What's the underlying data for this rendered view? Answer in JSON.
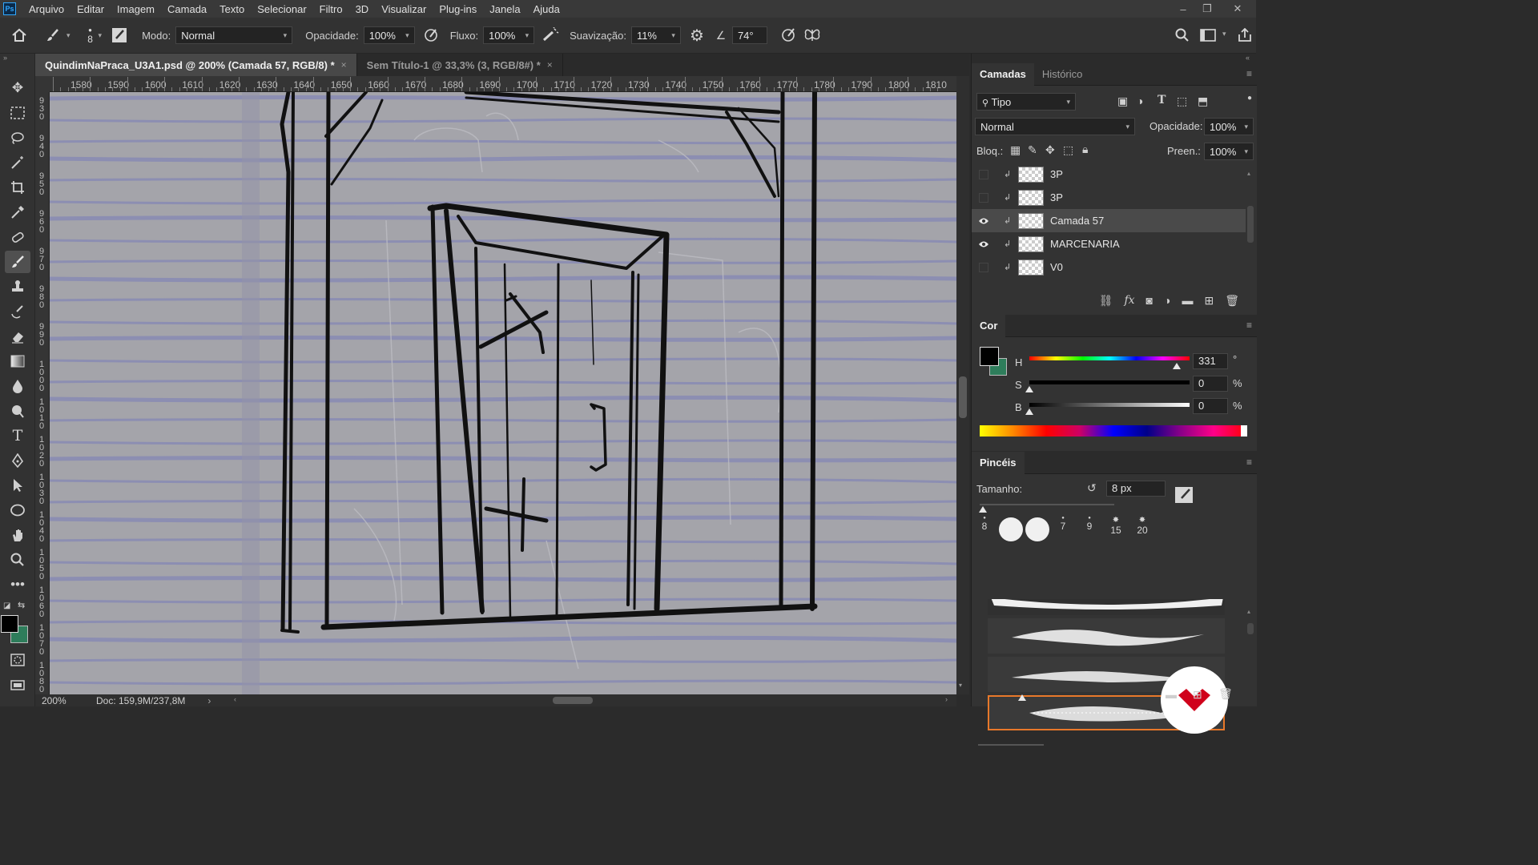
{
  "app": {
    "logo_text": "Ps",
    "menu": [
      "Arquivo",
      "Editar",
      "Imagem",
      "Camada",
      "Texto",
      "Selecionar",
      "Filtro",
      "3D",
      "Visualizar",
      "Plug-ins",
      "Janela",
      "Ajuda"
    ],
    "window_controls": {
      "minimize": "–",
      "restore": "❐",
      "close": "✕"
    }
  },
  "options": {
    "brush_size": "8",
    "mode_label": "Modo:",
    "mode_value": "Normal",
    "opacity_label": "Opacidade:",
    "opacity_value": "100%",
    "flow_label": "Fluxo:",
    "flow_value": "100%",
    "smoothing_label": "Suavização:",
    "smoothing_value": "11%",
    "angle_value": "74°"
  },
  "tabs": [
    {
      "label": "QuindimNaPraca_U3A1.psd @ 200% (Camada 57, RGB/8) *",
      "close": "×"
    },
    {
      "label": "Sem Título-1 @ 33,3% (3, RGB/8#) *",
      "close": "×"
    }
  ],
  "ruler": {
    "h_labels": [
      "1580",
      "1590",
      "1600",
      "1610",
      "1620",
      "1630",
      "1640",
      "1650",
      "1660",
      "1670",
      "1680",
      "1690",
      "1700",
      "1710",
      "1720",
      "1730",
      "1740",
      "1750",
      "1760",
      "1770",
      "1780",
      "1790",
      "1800",
      "1810"
    ],
    "v_labels": [
      "930",
      "940",
      "950",
      "960",
      "970",
      "980",
      "990",
      "1000",
      "1010",
      "1020",
      "1030",
      "1040",
      "1050",
      "1060",
      "1070",
      "1080"
    ]
  },
  "status": {
    "zoom": "200%",
    "doc": "Doc: 159,9M/237,8M",
    "arrow": "›"
  },
  "layers_panel": {
    "tabs": [
      "Camadas",
      "Histórico"
    ],
    "filter_label": "Tipo",
    "blend_mode": "Normal",
    "opacity_label": "Opacidade:",
    "opacity_value": "100%",
    "lock_label": "Bloq.:",
    "fill_label": "Preen.:",
    "fill_value": "100%",
    "layers": [
      {
        "name": "3P",
        "visible": false,
        "selected": false
      },
      {
        "name": "3P",
        "visible": false,
        "selected": false
      },
      {
        "name": "Camada 57",
        "visible": true,
        "selected": true
      },
      {
        "name": "MARCENARIA",
        "visible": true,
        "selected": false
      },
      {
        "name": "V0",
        "visible": false,
        "selected": false
      }
    ],
    "footer_fx": "fx"
  },
  "color_panel": {
    "title": "Cor",
    "h_label": "H",
    "h_value": "331",
    "h_unit": "°",
    "h_fraction": 0.92,
    "s_label": "S",
    "s_value": "0",
    "s_unit": "%",
    "s_fraction": 0.0,
    "b_label": "B",
    "b_value": "0",
    "b_unit": "%",
    "b_fraction": 0.0,
    "foreground": "#000000",
    "background": "#2e7d5b"
  },
  "brushes_panel": {
    "title": "Pincéis",
    "size_label": "Tamanho:",
    "size_value": "8 px",
    "presets": [
      "8",
      "",
      "",
      "7",
      "9",
      "15",
      "20"
    ]
  },
  "colors": {
    "canvas": "#a4a4aa",
    "stripe": "#8487b4",
    "accent_selection": "#e8782a",
    "logo": "#31a8ff",
    "brand_badge": "#d0021b"
  }
}
